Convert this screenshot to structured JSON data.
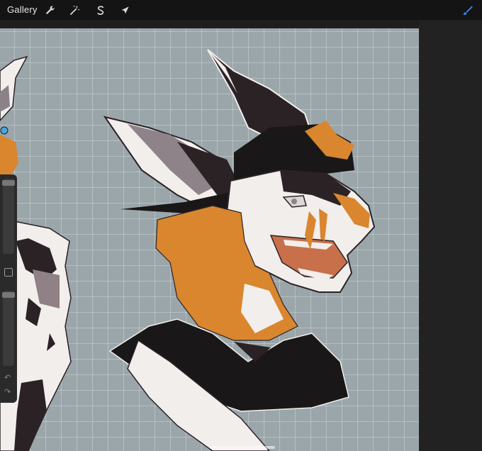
{
  "topbar": {
    "gallery_label": "Gallery",
    "tools": [
      {
        "name": "actions",
        "icon": "wrench-icon"
      },
      {
        "name": "adjustments",
        "icon": "magic-wand-icon"
      },
      {
        "name": "selection",
        "icon": "selection-s-icon"
      },
      {
        "name": "transform",
        "icon": "arrow-cursor-icon"
      }
    ],
    "brush": {
      "icon": "brush-icon",
      "color": "#2f7fe6"
    }
  },
  "canvas": {
    "background": "#9aa6aa",
    "grid": true
  },
  "sidebar": {
    "brush_size_slider": {
      "level": 0.08
    },
    "opacity_slider": {
      "level": 0.05
    },
    "modify_icon": "square-icon",
    "undo_icon": "undo-arrow-icon",
    "redo_icon": "redo-arrow-icon"
  },
  "colors": {
    "accent": "#2f7fe6",
    "fur_orange": "#d9862e",
    "fur_dark": "#2b2226",
    "fur_white": "#f2eeec",
    "shirt": "#1a1718"
  }
}
